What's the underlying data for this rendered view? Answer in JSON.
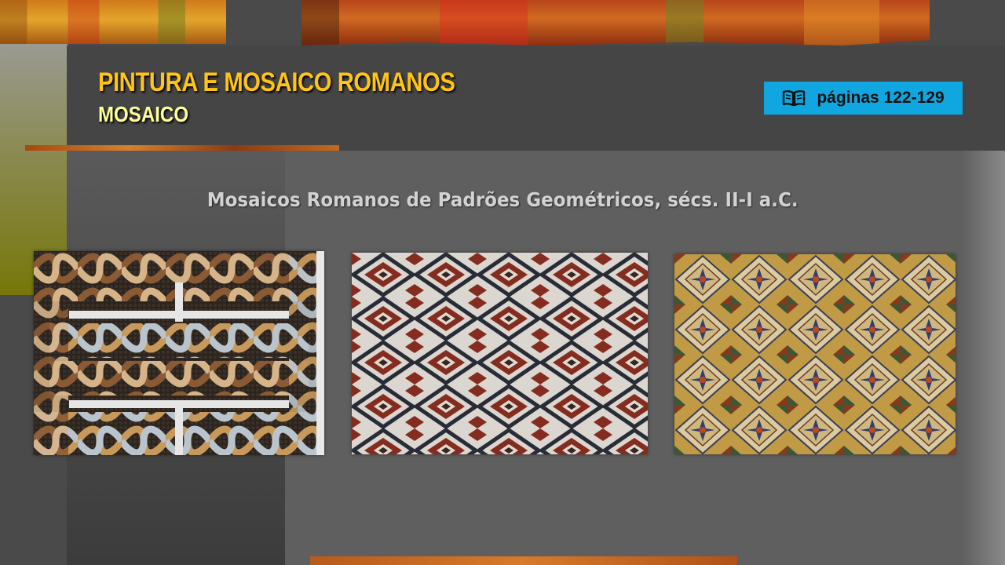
{
  "header": {
    "title": "PINTURA E MOSAICO ROMANOS",
    "subtitle": "MOSAICO"
  },
  "pages_badge": {
    "icon": "book-icon",
    "label": "páginas 122-129"
  },
  "caption": "Mosaicos Romanos de Padrões Geométricos, sécs. II-I a.C.",
  "colors": {
    "title": "#ffc414",
    "subtitle": "#ffff99",
    "badge": "#10a7e0",
    "background": "#4a4a4a"
  }
}
